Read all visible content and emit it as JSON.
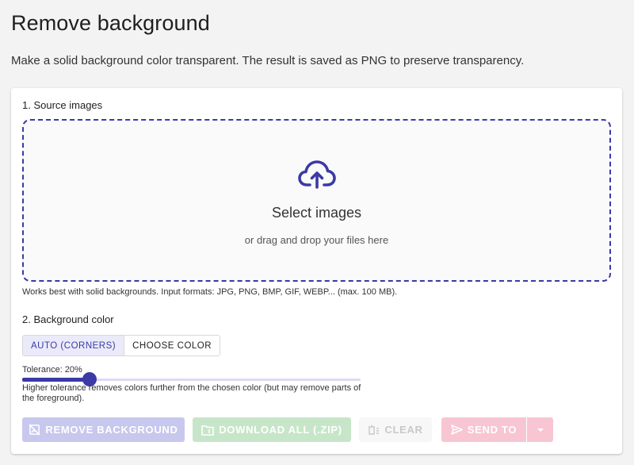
{
  "page": {
    "title": "Remove background",
    "description": "Make a solid background color transparent. The result is saved as PNG to preserve transparency."
  },
  "source": {
    "section_label": "1. Source images",
    "drop_title": "Select images",
    "drop_subtitle": "or drag and drop your files here",
    "icon": "cloud-upload-icon",
    "hint": "Works best with solid backgrounds. Input formats: JPG, PNG, BMP, GIF, WEBP... (max. 100 MB)."
  },
  "background": {
    "section_label": "2. Background color",
    "modes": [
      {
        "label": "AUTO (CORNERS)",
        "active": true
      },
      {
        "label": "CHOOSE COLOR",
        "active": false
      }
    ],
    "tolerance_label": "Tolerance: 20%",
    "tolerance_value": 20,
    "tolerance_help": "Higher tolerance removes colors further from the chosen color (but may remove parts of the foreground)."
  },
  "actions": {
    "remove_label": "REMOVE BACKGROUND",
    "download_label": "DOWNLOAD ALL (.ZIP)",
    "clear_label": "CLEAR",
    "send_label": "SEND TO"
  },
  "colors": {
    "accent": "#3b3aa6",
    "remove_disabled": "#c8c7ee",
    "download_disabled": "#c7e6c9",
    "send_disabled": "#f8c6d2"
  }
}
